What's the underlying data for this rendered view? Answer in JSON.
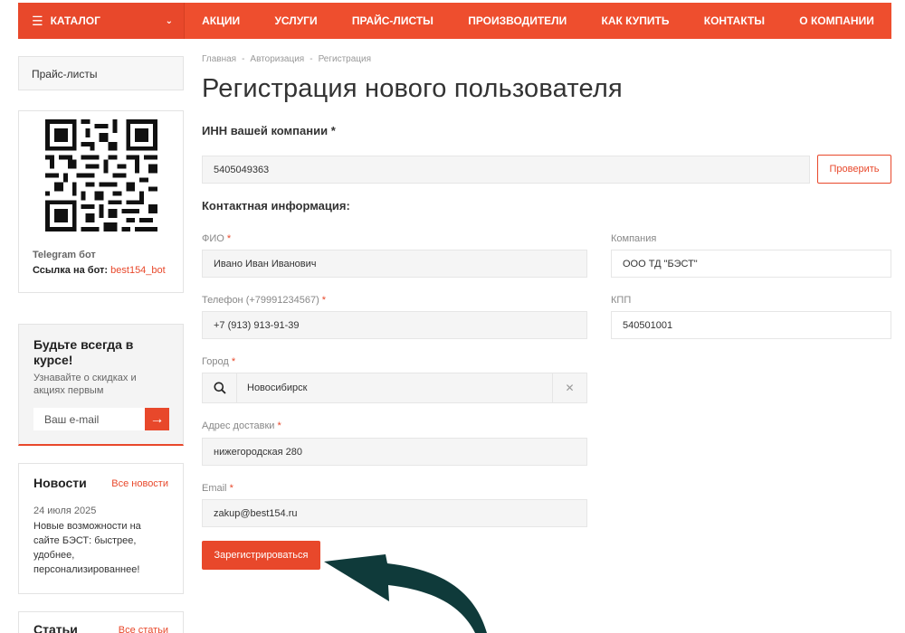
{
  "nav": {
    "catalog": "КАТАЛОГ",
    "items": [
      "АКЦИИ",
      "УСЛУГИ",
      "ПРАЙС-ЛИСТЫ",
      "ПРОИЗВОДИТЕЛИ",
      "КАК КУПИТЬ",
      "КОНТАКТЫ",
      "О КОМПАНИИ"
    ]
  },
  "sidebar": {
    "price_lists": "Прайс-листы",
    "telegram_title": "Telegram бот",
    "telegram_link_label": "Ссылка на бот:",
    "telegram_link": "best154_bot",
    "subscribe_title": "Будьте всегда в курсе!",
    "subscribe_text": "Узнавайте о скидках и акциях первым",
    "subscribe_placeholder": "Ваш e-mail",
    "news_title": "Новости",
    "news_all": "Все новости",
    "news_date": "24 июля 2025",
    "news_text": "Новые возможности на сайте БЭСТ: быстрее, удобнее, персонализированнее!",
    "articles_title": "Статьи",
    "articles_all": "Все статьи"
  },
  "breadcrumb": [
    "Главная",
    "Авторизация",
    "Регистрация"
  ],
  "page_title": "Регистрация нового пользователя",
  "form": {
    "inn_label": "ИНН вашей компании *",
    "inn_value": "5405049363",
    "check_button": "Проверить",
    "contact_section": "Контактная информация:",
    "fio_label": "ФИО",
    "fio_value": "Ивано Иван Иванович",
    "company_label": "Компания",
    "company_value": "ООО ТД \"БЭСТ\"",
    "phone_label": "Телефон (+79991234567)",
    "phone_value": "+7 (913) 913-91-39",
    "kpp_label": "КПП",
    "kpp_value": "540501001",
    "city_label": "Город",
    "city_value": "Новосибирск",
    "address_label": "Адрес доставки",
    "address_value": "нижегородская 280",
    "email_label": "Email",
    "email_value": "zakup@best154.ru",
    "required_mark": "*",
    "register_button": "Зарегистрироваться"
  },
  "colors": {
    "accent": "#e8482b",
    "annotation_arrow": "#0f3a3a"
  }
}
